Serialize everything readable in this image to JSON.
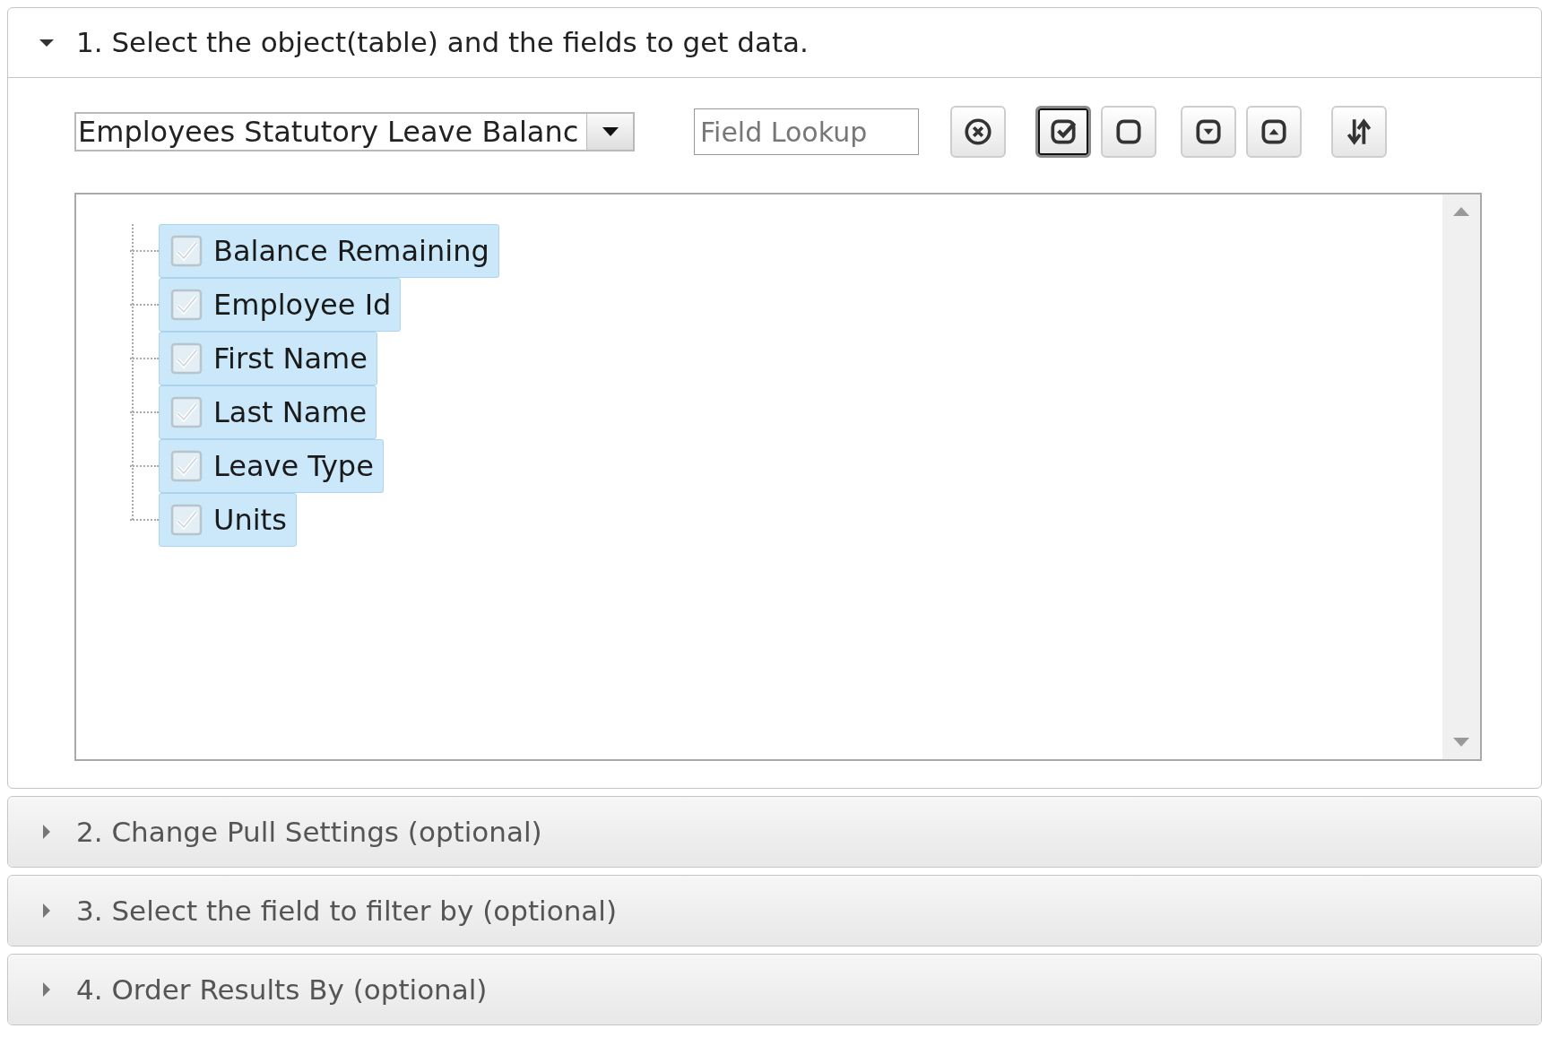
{
  "sections": [
    {
      "title": "1. Select the object(table) and the fields to get data.",
      "expanded": true
    },
    {
      "title": "2. Change Pull Settings (optional)",
      "expanded": false
    },
    {
      "title": "3. Select the field to filter by (optional)",
      "expanded": false
    },
    {
      "title": "4. Order Results By (optional)",
      "expanded": false
    }
  ],
  "object_select": {
    "value": "Employees Statutory Leave Balanc"
  },
  "field_lookup": {
    "placeholder": "Field Lookup"
  },
  "toolbar": [
    {
      "kind": "clear",
      "selected": false
    },
    {
      "kind": "check_all",
      "selected": true
    },
    {
      "kind": "uncheck_all",
      "selected": false
    },
    {
      "kind": "expand_all",
      "selected": false
    },
    {
      "kind": "collapse_all",
      "selected": false
    },
    {
      "kind": "sort",
      "selected": false
    }
  ],
  "fields": [
    {
      "label": "Balance Remaining",
      "checked": true,
      "selected": true
    },
    {
      "label": "Employee Id",
      "checked": true,
      "selected": true
    },
    {
      "label": "First Name",
      "checked": true,
      "selected": true
    },
    {
      "label": "Last Name",
      "checked": true,
      "selected": true
    },
    {
      "label": "Leave Type",
      "checked": true,
      "selected": true
    },
    {
      "label": "Units",
      "checked": true,
      "selected": true
    }
  ]
}
